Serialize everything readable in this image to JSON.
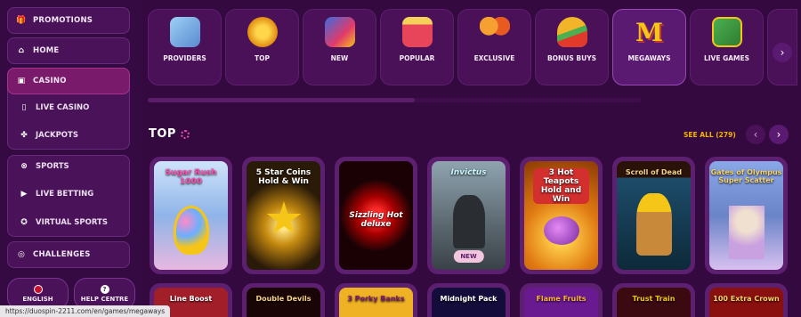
{
  "sidebar": {
    "items": [
      {
        "label": "PROMOTIONS",
        "icon": "gift-icon"
      },
      {
        "label": "HOME",
        "icon": "home-icon"
      },
      {
        "label": "CASINO",
        "icon": "slot-machine-icon"
      },
      {
        "label": "LIVE CASINO",
        "icon": "phone-icon"
      },
      {
        "label": "JACKPOTS",
        "icon": "clover-icon"
      },
      {
        "label": "SPORTS",
        "icon": "ball-icon"
      },
      {
        "label": "LIVE BETTING",
        "icon": "play-icon"
      },
      {
        "label": "VIRTUAL SPORTS",
        "icon": "gamepad-icon"
      },
      {
        "label": "CHALLENGES",
        "icon": "target-icon"
      }
    ],
    "bottom": {
      "language": "ENGLISH",
      "help": "HELP CENTRE"
    }
  },
  "categories": [
    {
      "label": "PROVIDERS",
      "color": "#7bb3e0"
    },
    {
      "label": "TOP",
      "color": "#f2a71a"
    },
    {
      "label": "NEW",
      "color": "#e23a6a"
    },
    {
      "label": "POPULAR",
      "color": "#e8455a"
    },
    {
      "label": "EXCLUSIVE",
      "color": "#f08a1e"
    },
    {
      "label": "BONUS BUYS",
      "color": "#f2b52a"
    },
    {
      "label": "MEGAWAYS",
      "color": "#f5c518"
    },
    {
      "label": "LIVE GAMES",
      "color": "#4caf50"
    }
  ],
  "section": {
    "title": "TOP",
    "see_all": "SEE ALL (279)"
  },
  "games": [
    {
      "name": "Sugar Rush 1000",
      "bg": "#9ec6ef"
    },
    {
      "name": "5 Star Coins Hold & Win",
      "bg": "#2a1a08"
    },
    {
      "name": "Sizzling Hot deluxe",
      "bg": "#2a0406"
    },
    {
      "name": "Invictus",
      "bg": "#66727a",
      "badge": "NEW"
    },
    {
      "name": "3 Hot Teapots Hold and Win",
      "bg": "#e07912"
    },
    {
      "name": "Scroll of Dead",
      "bg": "#1d4c6a"
    },
    {
      "name": "Gates of Olympus Super Scatter",
      "bg": "#6a84c8"
    }
  ],
  "games_row2": [
    {
      "name": "Line Boost",
      "bg": "#a21f2a"
    },
    {
      "name": "Double Devils",
      "bg": "#1a0506"
    },
    {
      "name": "3 Porky Banks",
      "bg": "#f0b225"
    },
    {
      "name": "Midnight Pack",
      "bg": "#140c3a"
    },
    {
      "name": "Flame Fruits",
      "bg": "#6a1a90"
    },
    {
      "name": "Trust Train",
      "bg": "#3a0a10"
    },
    {
      "name": "100 Extra Crown",
      "bg": "#8a1010"
    }
  ],
  "status_url": "https://duospin-2211.com/en/games/megaways"
}
